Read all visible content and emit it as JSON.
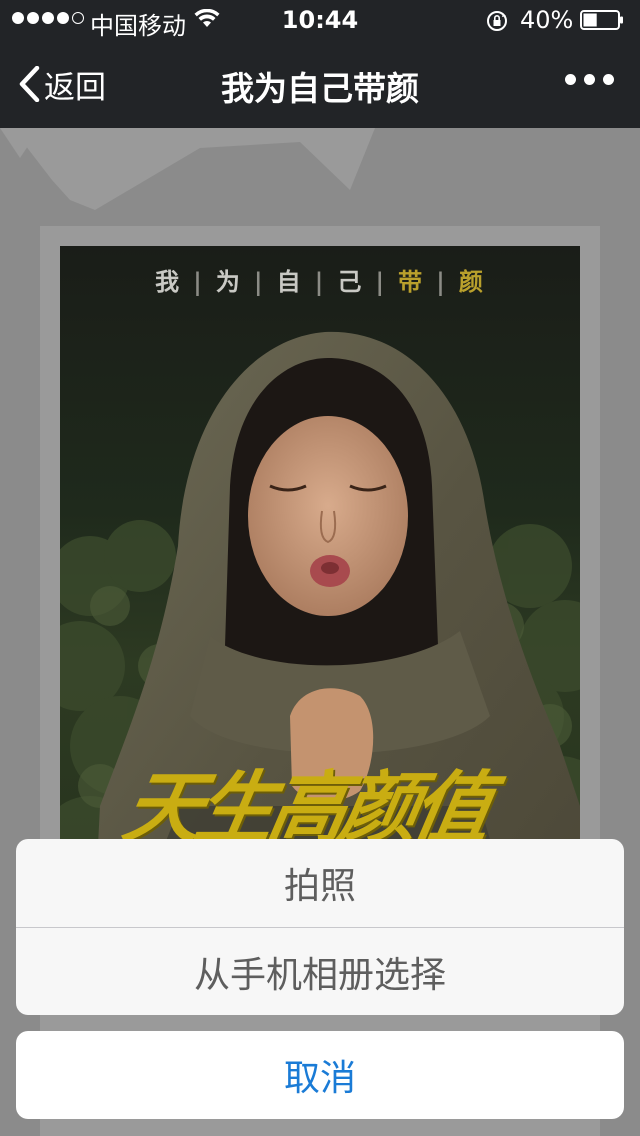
{
  "status_bar": {
    "carrier": "中国移动",
    "time": "10:44",
    "battery_percent": "40%",
    "battery_level": 0.4,
    "signal_bars_filled": 4,
    "signal_bars_total": 5,
    "icons": [
      "signal-dots-icon",
      "wifi-icon",
      "rotation-lock-icon",
      "battery-icon"
    ]
  },
  "nav": {
    "back_label": "返回",
    "title": "我为自己带颜",
    "more_icon": "more-dots-icon"
  },
  "poster": {
    "header_words": [
      "我",
      "为",
      "自",
      "己",
      "带",
      "颜"
    ],
    "header_separator": "|",
    "slogan": "天生高颜值",
    "accent_color": "#c9ad12"
  },
  "action_sheet": {
    "options": [
      {
        "label": "拍照"
      },
      {
        "label": "从手机相册选择"
      }
    ],
    "cancel_label": "取消",
    "cancel_color": "#1a7bd6"
  }
}
